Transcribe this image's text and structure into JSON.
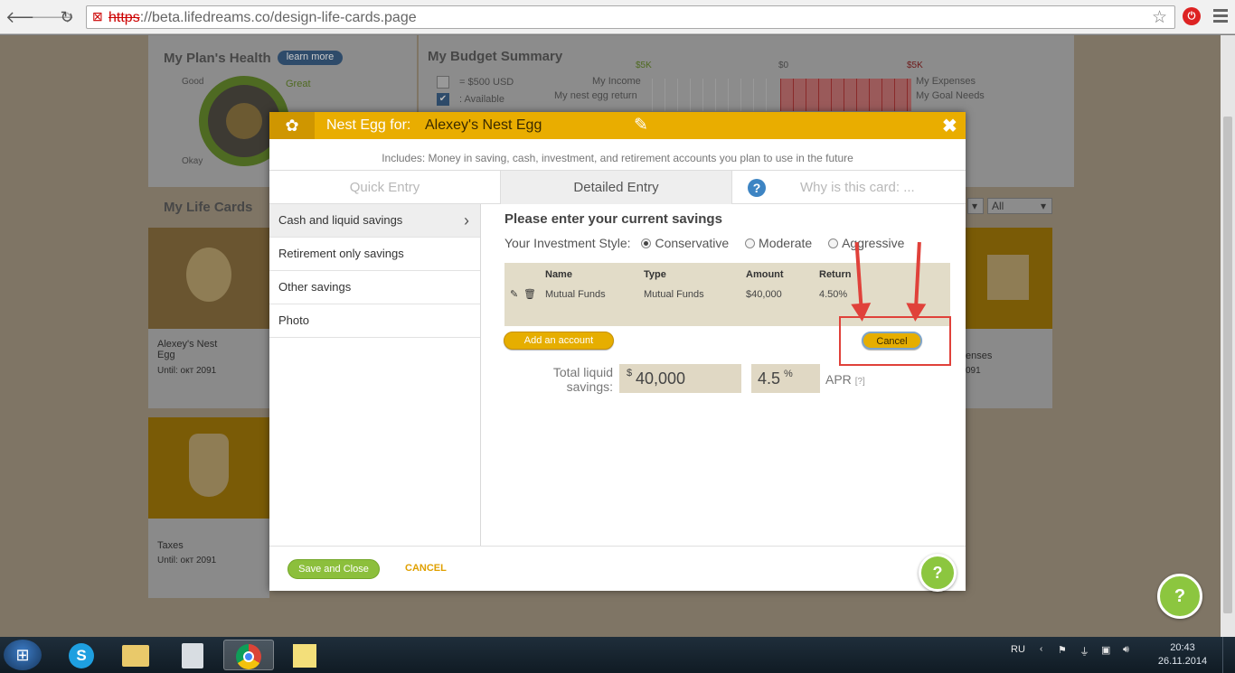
{
  "browser": {
    "url_protocol": "https",
    "url_rest": "://beta.lifedreams.co/design-life-cards.page",
    "back_glyph": "🡐",
    "forward_glyph": "🡒",
    "reload_glyph": "↻",
    "star_glyph": "☆"
  },
  "background": {
    "health_title": "My Plan's Health",
    "learn_more": "learn more",
    "good": "Good",
    "great": "Great",
    "okay": "Okay",
    "budget_title": "My Budget Summary",
    "legend_usd": "= $500 USD",
    "legend_available": ": Available",
    "my_income": "My Income",
    "my_nest_egg_return": "My nest egg return",
    "my_expenses": "My Expenses",
    "my_goal_needs": "My Goal Needs",
    "scale_left": "$5K",
    "scale_mid": "$0",
    "scale_right": "$5K",
    "life_cards_title": "My Life Cards",
    "filter_all": "All",
    "cards": [
      {
        "name": "Alexey's Nest Egg",
        "until": "Until: окт 2091"
      },
      {
        "name": "Taxes",
        "until": "Until: окт 2091"
      },
      {
        "name": "enses",
        "until": "091"
      }
    ]
  },
  "modal": {
    "header_label": "Nest Egg for:",
    "header_name": "Alexey's Nest Egg",
    "close_glyph": "✖",
    "edit_glyph": "✎",
    "subtitle": "Includes: Money in saving, cash, investment, and retirement accounts you plan to use in the future",
    "tabs": [
      {
        "label": "Quick Entry"
      },
      {
        "label": "Detailed Entry"
      },
      {
        "label": "Why is this card: ..."
      }
    ],
    "sidebar": [
      {
        "label": "Cash and liquid savings"
      },
      {
        "label": "Retirement only savings"
      },
      {
        "label": "Other savings"
      },
      {
        "label": "Photo"
      }
    ],
    "content": {
      "title": "Please enter your current savings",
      "investment_label": "Your Investment Style:",
      "options": [
        {
          "label": "Conservative",
          "selected": true
        },
        {
          "label": "Moderate",
          "selected": false
        },
        {
          "label": "Aggressive",
          "selected": false
        }
      ],
      "table_headers": {
        "name": "Name",
        "type": "Type",
        "amount": "Amount",
        "return": "Return"
      },
      "rows": [
        {
          "name": "Mutual Funds",
          "type": "Mutual Funds",
          "amount": "$40,000",
          "return": "4.50%"
        }
      ],
      "add_account": "Add an account",
      "cancel": "Cancel",
      "total_label": "Total liquid savings:",
      "currency": "$",
      "total_value": "40,000",
      "apr_value": "4.5",
      "apr_pct": "%",
      "apr_label": "APR",
      "apr_help": "[?]"
    },
    "footer": {
      "save_close": "Save and Close",
      "cancel": "CANCEL"
    }
  },
  "taskbar": {
    "lang": "RU",
    "time": "20:43",
    "date": "26.11.2014"
  },
  "colors": {
    "accent_gold": "#e9ad00",
    "accent_green": "#8cbf3c",
    "annotation_red": "#e0413a"
  }
}
